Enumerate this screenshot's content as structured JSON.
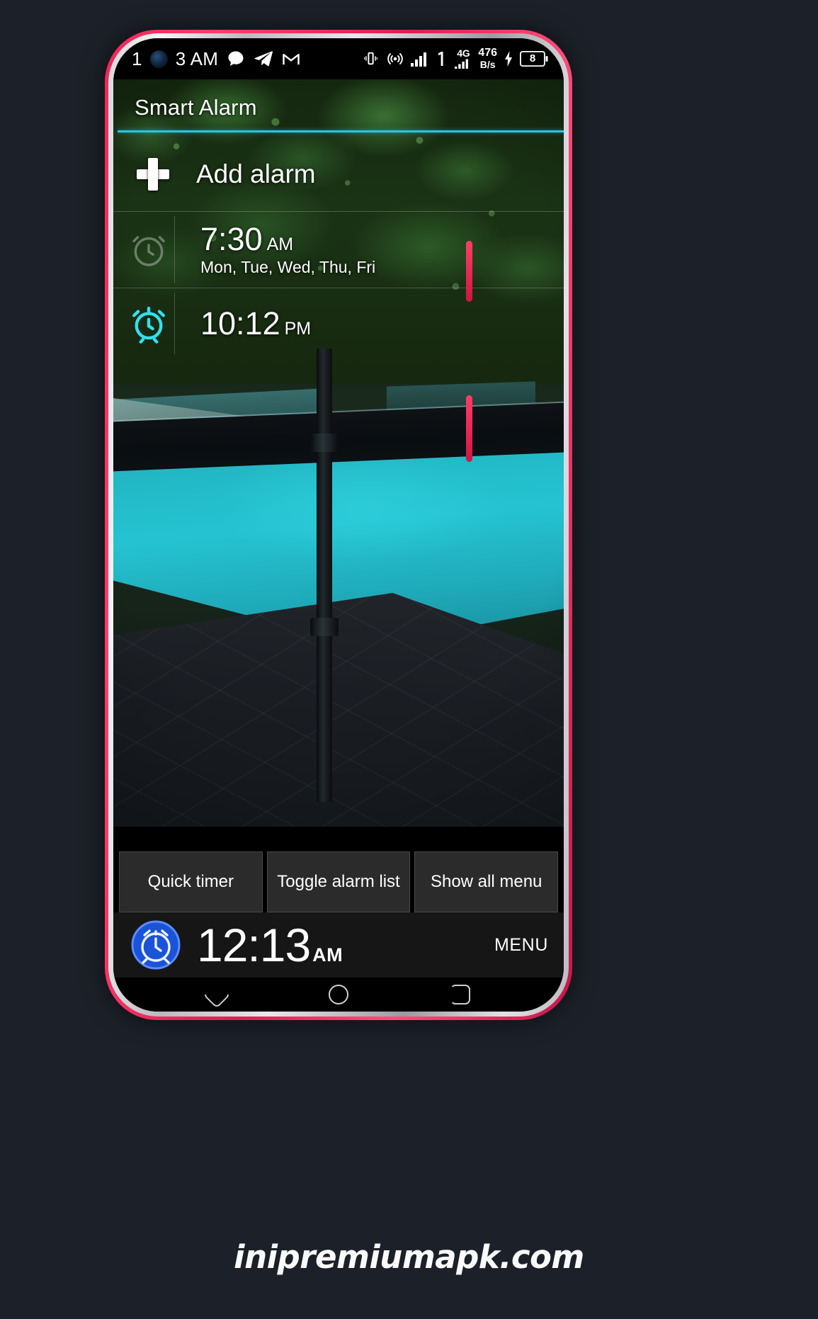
{
  "statusbar": {
    "time": "1",
    "clock": "3 AM",
    "icons_left": [
      "camera-punch-hole",
      "chat-bubble-icon",
      "telegram-icon",
      "gmail-icon"
    ],
    "icons_right": [
      "vibrate-icon",
      "hotspot-icon",
      "signal-bars-icon",
      "sim-one-icon",
      "4g-signal-icon"
    ],
    "network_label": "4G",
    "data_speed_value": "476",
    "data_speed_unit": "B/s",
    "battery_level": "8",
    "charging": true
  },
  "app": {
    "title": "Smart Alarm",
    "accent": "#29c3e8",
    "add_alarm": {
      "label": "Add alarm",
      "icon": "plus-icon"
    },
    "alarms": [
      {
        "time": "7:30",
        "meridiem": "AM",
        "days": "Mon, Tue, Wed, Thu, Fri",
        "enabled": false,
        "icon": "alarm-clock-icon"
      },
      {
        "time": "10:12",
        "meridiem": "PM",
        "days": "",
        "enabled": true,
        "icon": "alarm-clock-icon"
      }
    ],
    "buttons": [
      {
        "label": "Quick timer",
        "name": "quick-timer-button"
      },
      {
        "label": "Toggle alarm list",
        "name": "toggle-alarm-list-button"
      },
      {
        "label": "Show all menu",
        "name": "show-all-menu-button"
      }
    ],
    "clockbar": {
      "icon": "blue-alarm-clock-icon",
      "time": "12:13",
      "meridiem": "AM",
      "menu_label": "MENU"
    }
  },
  "navbar": {
    "recents": "recents-icon",
    "home": "home-icon",
    "back": "back-icon"
  },
  "watermark": "inipremiumapk.com"
}
